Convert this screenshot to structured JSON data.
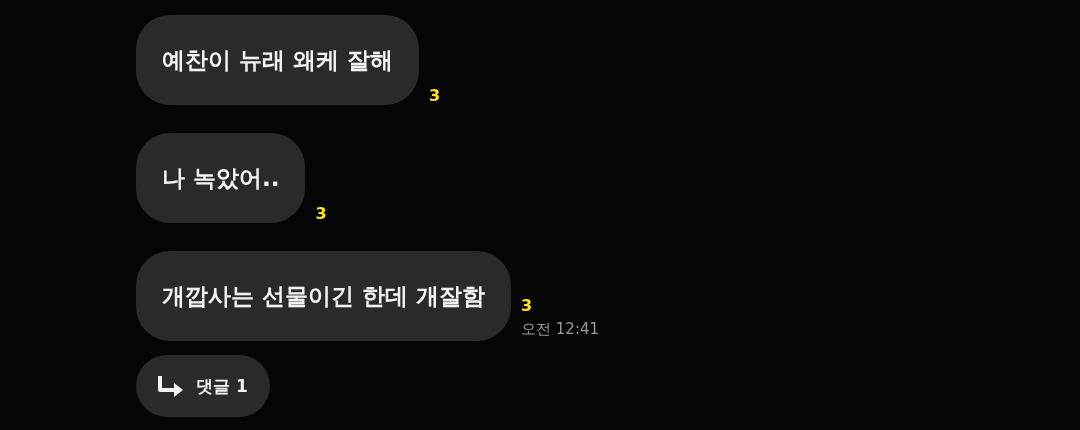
{
  "messages": [
    {
      "text": "예찬이 뉴래 왜케 잘해",
      "unread_count": "3"
    },
    {
      "text": "나 녹았어..",
      "unread_count": "3"
    },
    {
      "text": "개깝사는 선물이긴 한데 개잘함",
      "unread_count": "3",
      "time": "오전 12:41"
    }
  ],
  "reply": {
    "label": "댓글 1"
  }
}
